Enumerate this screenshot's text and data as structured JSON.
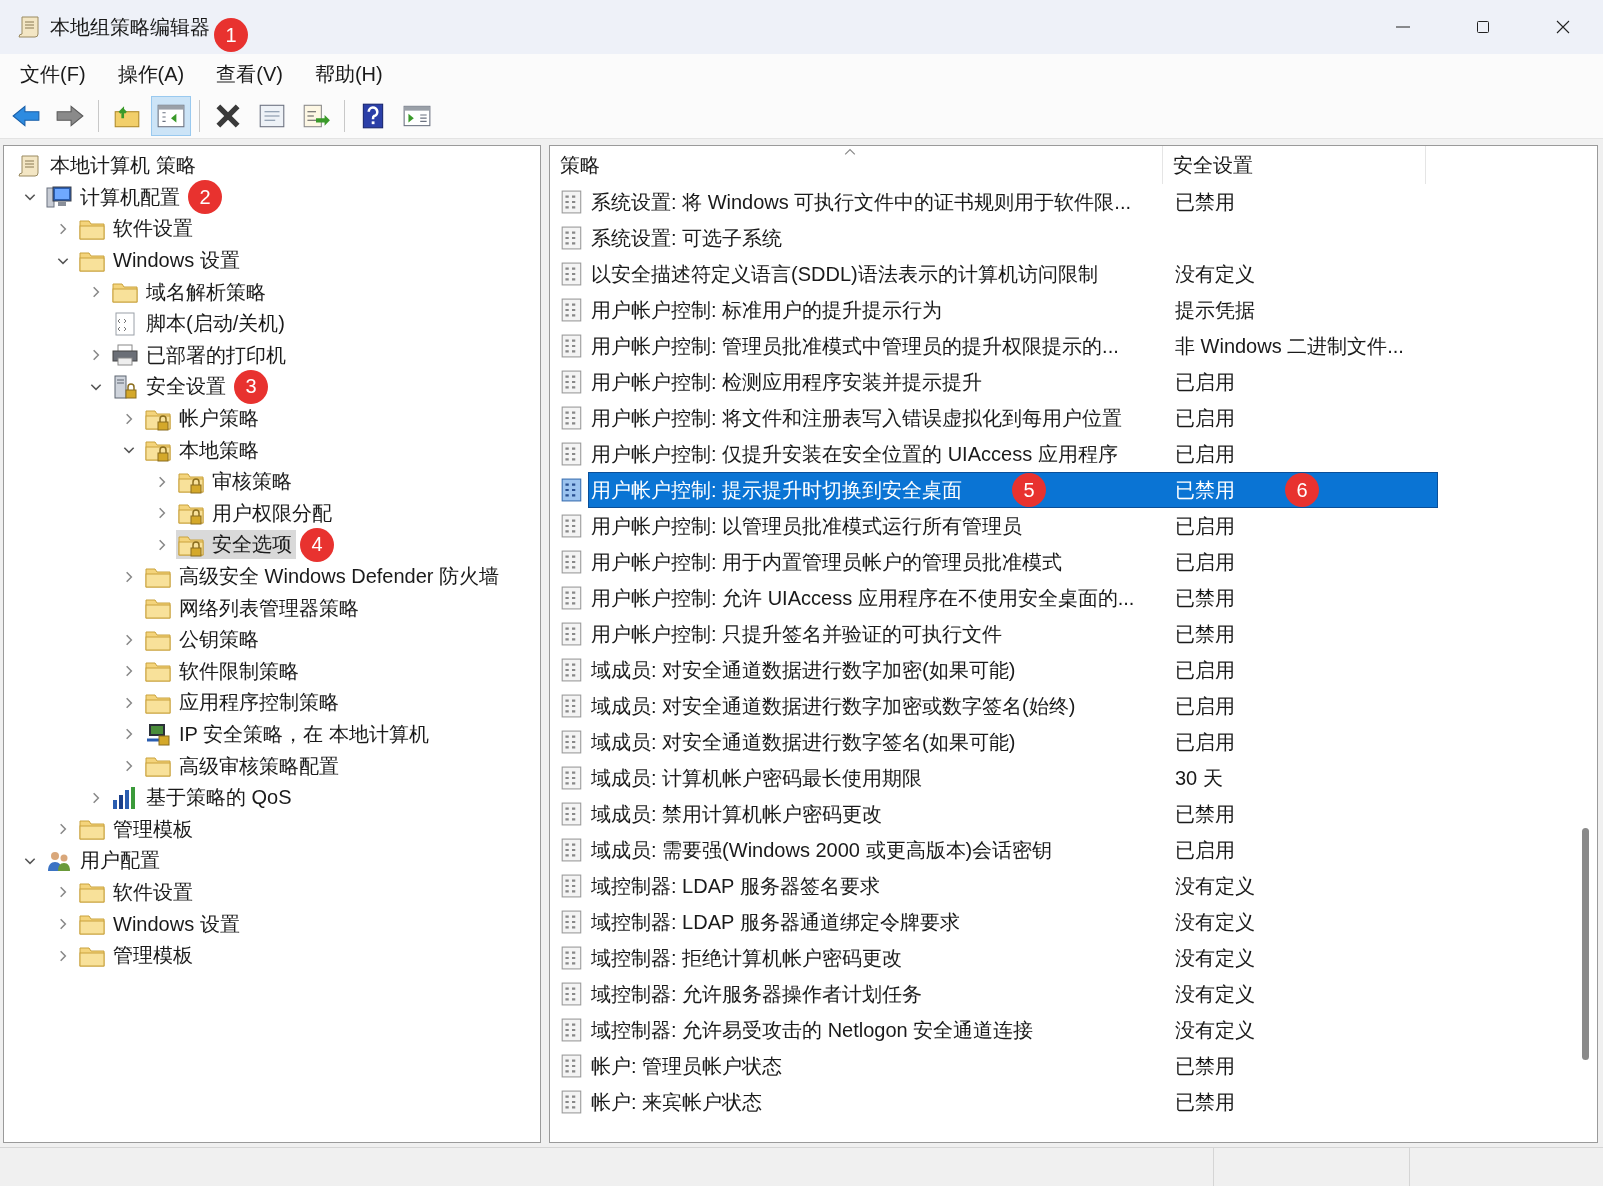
{
  "window": {
    "title": "本地组策略编辑器",
    "title_annotation": "1"
  },
  "menu": [
    "文件(F)",
    "操作(A)",
    "查看(V)",
    "帮助(H)"
  ],
  "toolbar": [
    {
      "kind": "back",
      "pressed": false
    },
    {
      "kind": "forward",
      "pressed": false
    },
    {
      "kind": "separator"
    },
    {
      "kind": "up",
      "pressed": false
    },
    {
      "kind": "tree-toggle",
      "pressed": true
    },
    {
      "kind": "separator"
    },
    {
      "kind": "delete",
      "pressed": false
    },
    {
      "kind": "properties",
      "pressed": false
    },
    {
      "kind": "export",
      "pressed": false
    },
    {
      "kind": "separator"
    },
    {
      "kind": "help",
      "pressed": false
    },
    {
      "kind": "action-pane",
      "pressed": false
    }
  ],
  "tree": {
    "root": {
      "label": "本地计算机 策略",
      "kind": "scroll",
      "selected": false,
      "children": [
        {
          "label": "计算机配置",
          "kind": "computer",
          "expanded": true,
          "selected": false,
          "annotation": "2",
          "children": [
            {
              "label": "软件设置",
              "kind": "folder",
              "expanded": false,
              "selected": false
            },
            {
              "label": "Windows 设置",
              "kind": "folder",
              "expanded": true,
              "selected": false,
              "children": [
                {
                  "label": "域名解析策略",
                  "kind": "folder",
                  "expanded": false,
                  "selected": false
                },
                {
                  "label": "脚本(启动/关机)",
                  "kind": "script",
                  "selected": false
                },
                {
                  "label": "已部署的打印机",
                  "kind": "printer",
                  "expanded": false,
                  "selected": false
                },
                {
                  "label": "安全设置",
                  "kind": "security",
                  "expanded": true,
                  "selected": false,
                  "annotation": "3",
                  "children": [
                    {
                      "label": "帐户策略",
                      "kind": "lock-folder",
                      "expanded": false,
                      "selected": false
                    },
                    {
                      "label": "本地策略",
                      "kind": "lock-folder",
                      "expanded": true,
                      "selected": false,
                      "children": [
                        {
                          "label": "审核策略",
                          "kind": "lock-folder",
                          "expanded": false,
                          "selected": false
                        },
                        {
                          "label": "用户权限分配",
                          "kind": "lock-folder",
                          "expanded": false,
                          "selected": false
                        },
                        {
                          "label": "安全选项",
                          "kind": "lock-folder",
                          "expanded": false,
                          "selected": true,
                          "annotation": "4"
                        }
                      ]
                    },
                    {
                      "label": "高级安全 Windows Defender 防火墙",
                      "kind": "folder",
                      "expanded": false,
                      "selected": false
                    },
                    {
                      "label": "网络列表管理器策略",
                      "kind": "folder",
                      "selected": false
                    },
                    {
                      "label": "公钥策略",
                      "kind": "folder",
                      "expanded": false,
                      "selected": false
                    },
                    {
                      "label": "软件限制策略",
                      "kind": "folder",
                      "expanded": false,
                      "selected": false
                    },
                    {
                      "label": "应用程序控制策略",
                      "kind": "folder",
                      "expanded": false,
                      "selected": false
                    },
                    {
                      "label": "IP 安全策略，在 本地计算机",
                      "kind": "network",
                      "expanded": false,
                      "selected": false
                    },
                    {
                      "label": "高级审核策略配置",
                      "kind": "folder",
                      "expanded": false,
                      "selected": false
                    }
                  ]
                },
                {
                  "label": "基于策略的 QoS",
                  "kind": "chart",
                  "expanded": false,
                  "selected": false
                }
              ]
            },
            {
              "label": "管理模板",
              "kind": "folder",
              "expanded": false,
              "selected": false
            }
          ]
        },
        {
          "label": "用户配置",
          "kind": "user",
          "expanded": true,
          "selected": false,
          "children": [
            {
              "label": "软件设置",
              "kind": "folder",
              "expanded": false,
              "selected": false
            },
            {
              "label": "Windows 设置",
              "kind": "folder",
              "expanded": false,
              "selected": false
            },
            {
              "label": "管理模板",
              "kind": "folder",
              "expanded": false,
              "selected": false
            }
          ]
        }
      ]
    }
  },
  "list": {
    "columns": [
      {
        "label": "策略",
        "sorted": true
      },
      {
        "label": "安全设置",
        "sorted": false
      }
    ],
    "rows": [
      {
        "policy": "系统设置: 将 Windows 可执行文件中的证书规则用于软件限...",
        "setting": "已禁用",
        "selected": false
      },
      {
        "policy": "系统设置: 可选子系统",
        "selected": false
      },
      {
        "policy": "以安全描述符定义语言(SDDL)语法表示的计算机访问限制",
        "setting": "没有定义",
        "selected": false
      },
      {
        "policy": "用户帐户控制: 标准用户的提升提示行为",
        "setting": "提示凭据",
        "selected": false
      },
      {
        "policy": "用户帐户控制: 管理员批准模式中管理员的提升权限提示的...",
        "setting": "非 Windows 二进制文件...",
        "selected": false
      },
      {
        "policy": "用户帐户控制: 检测应用程序安装并提示提升",
        "setting": "已启用",
        "selected": false
      },
      {
        "policy": "用户帐户控制: 将文件和注册表写入错误虚拟化到每用户位置",
        "setting": "已启用",
        "selected": false
      },
      {
        "policy": "用户帐户控制: 仅提升安装在安全位置的 UIAccess 应用程序",
        "setting": "已启用",
        "selected": false
      },
      {
        "policy": "用户帐户控制: 提示提升时切换到安全桌面",
        "setting": "已禁用",
        "selected": true,
        "policy_annotation": "5",
        "setting_annotation": "6"
      },
      {
        "policy": "用户帐户控制: 以管理员批准模式运行所有管理员",
        "setting": "已启用",
        "selected": false
      },
      {
        "policy": "用户帐户控制: 用于内置管理员帐户的管理员批准模式",
        "setting": "已启用",
        "selected": false
      },
      {
        "policy": "用户帐户控制: 允许 UIAccess 应用程序在不使用安全桌面的...",
        "setting": "已禁用",
        "selected": false
      },
      {
        "policy": "用户帐户控制: 只提升签名并验证的可执行文件",
        "setting": "已禁用",
        "selected": false
      },
      {
        "policy": "域成员: 对安全通道数据进行数字加密(如果可能)",
        "setting": "已启用",
        "selected": false
      },
      {
        "policy": "域成员: 对安全通道数据进行数字加密或数字签名(始终)",
        "setting": "已启用",
        "selected": false
      },
      {
        "policy": "域成员: 对安全通道数据进行数字签名(如果可能)",
        "setting": "已启用",
        "selected": false
      },
      {
        "policy": "域成员: 计算机帐户密码最长使用期限",
        "setting": "30 天",
        "selected": false
      },
      {
        "policy": "域成员: 禁用计算机帐户密码更改",
        "setting": "已禁用",
        "selected": false
      },
      {
        "policy": "域成员: 需要强(Windows 2000 或更高版本)会话密钥",
        "setting": "已启用",
        "selected": false
      },
      {
        "policy": "域控制器: LDAP 服务器签名要求",
        "setting": "没有定义",
        "selected": false
      },
      {
        "policy": "域控制器: LDAP 服务器通道绑定令牌要求",
        "setting": "没有定义",
        "selected": false
      },
      {
        "policy": "域控制器: 拒绝计算机帐户密码更改",
        "setting": "没有定义",
        "selected": false
      },
      {
        "policy": "域控制器: 允许服务器操作者计划任务",
        "setting": "没有定义",
        "selected": false
      },
      {
        "policy": "域控制器: 允许易受攻击的 Netlogon 安全通道连接",
        "setting": "没有定义",
        "selected": false
      },
      {
        "policy": "帐户: 管理员帐户状态",
        "setting": "已禁用",
        "selected": false
      },
      {
        "policy": "帐户: 来宾帐户状态",
        "setting": "已禁用",
        "selected": false
      }
    ]
  }
}
